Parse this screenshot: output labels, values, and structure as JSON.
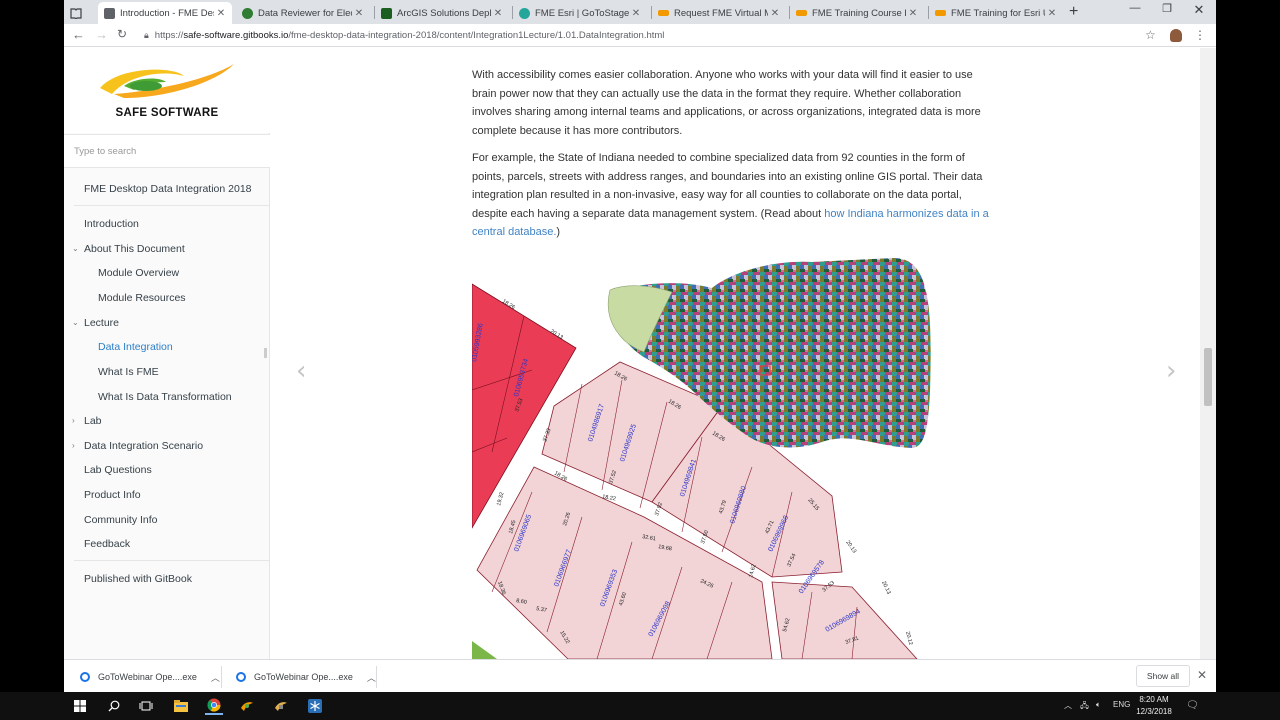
{
  "tabs": [
    {
      "label": "Introduction - FME Desktop",
      "active": true,
      "favicon_color": "#5f6368"
    },
    {
      "label": "Data Reviewer for Electric",
      "active": false,
      "favicon_color": "#2e7d32"
    },
    {
      "label": "ArcGIS Solutions Deployment",
      "active": false,
      "favicon_color": "#1b5e20"
    },
    {
      "label": "FME Esri | GoToStage.com",
      "active": false,
      "favicon_color": "#26a69a"
    },
    {
      "label": "Request FME Virtual Machine",
      "active": false,
      "favicon_color": "#f29900"
    },
    {
      "label": "FME Training Course Resources",
      "active": false,
      "favicon_color": "#f29900"
    },
    {
      "label": "FME Training for Esri Utility",
      "active": false,
      "favicon_color": "#f29900"
    }
  ],
  "address_bar": {
    "scheme": "https://",
    "host": "safe-software.gitbooks.io",
    "path": "/fme-desktop-data-integration-2018/content/Integration1Lecture/1.01.DataIntegration.html"
  },
  "sidebar": {
    "logo_text": "SAFE SOFTWARE",
    "search_placeholder": "Type to search",
    "book_title": "FME Desktop Data Integration 2018",
    "items": [
      {
        "label": "Introduction",
        "level": 0,
        "caret": false,
        "current": false
      },
      {
        "label": "About This Document",
        "level": 0,
        "caret": "down",
        "current": false
      },
      {
        "label": "Module Overview",
        "level": 1,
        "caret": false,
        "current": false
      },
      {
        "label": "Module Resources",
        "level": 1,
        "caret": false,
        "current": false
      },
      {
        "label": "Lecture",
        "level": 0,
        "caret": "down",
        "current": false
      },
      {
        "label": "Data Integration",
        "level": 1,
        "caret": false,
        "current": true
      },
      {
        "label": "What Is FME",
        "level": 1,
        "caret": false,
        "current": false
      },
      {
        "label": "What Is Data Transformation",
        "level": 1,
        "caret": false,
        "current": false
      },
      {
        "label": "Lab",
        "level": 0,
        "caret": "right",
        "current": false
      },
      {
        "label": "Data Integration Scenario",
        "level": 0,
        "caret": "right",
        "current": false
      },
      {
        "label": "Lab Questions",
        "level": 0,
        "caret": false,
        "current": false
      },
      {
        "label": "Product Info",
        "level": 0,
        "caret": false,
        "current": false
      },
      {
        "label": "Community Info",
        "level": 0,
        "caret": false,
        "current": false
      },
      {
        "label": "Feedback",
        "level": 0,
        "caret": false,
        "current": false
      }
    ],
    "footer": "Published with GitBook"
  },
  "content": {
    "para1": "With accessibility comes easier collaboration. Anyone who works with your data will find it easier to use brain power now that they can actually use the data in the format they require. Whether collaboration involves sharing among internal teams and applications, or across organizations, integrated data is more complete because it has more contributors.",
    "para2_text": "For example, the State of Indiana needed to combine specialized data from 92 counties in the form of points, parcels, streets with address ranges, and boundaries into an existing online GIS portal. Their data integration plan resulted in a non-invasive, easy way for all counties to collaborate on the data portal, despite each having a separate data management system. (Read about ",
    "para2_link": "how Indiana harmonizes data in a central database.",
    "para2_end": ")",
    "parcel_ids": [
      "0105993286",
      "0106953734",
      "0104986917",
      "0104969925",
      "0104969841",
      "0106969880",
      "0106969968",
      "0106969065",
      "0106966977",
      "0106969353",
      "0106969098",
      "0106969578",
      "0106969894"
    ],
    "dimension_labels": [
      "18.26",
      "20.13",
      "18.26",
      "37.53",
      "18.26",
      "37.33",
      "18.26",
      "37.52",
      "18.26",
      "37.92",
      "19.68",
      "37.50",
      "25.15",
      "20.13",
      "37.54",
      "37.53",
      "37.81",
      "18.36",
      "8.60",
      "5.37",
      "15.22",
      "43.60",
      "18.45",
      "18.22",
      "19.32",
      "32.61",
      "20.26",
      "43.79",
      "43.71",
      "20.13",
      "20.12",
      "24.26",
      "14.62",
      "54.62"
    ]
  },
  "downloads": [
    {
      "label": "GoToWebinar Ope....exe"
    },
    {
      "label": "GoToWebinar Ope....exe"
    }
  ],
  "download_bar": {
    "show_all": "Show all"
  },
  "taskbar": {
    "time": "8:20 AM",
    "date": "12/3/2018",
    "language": "ENG"
  }
}
